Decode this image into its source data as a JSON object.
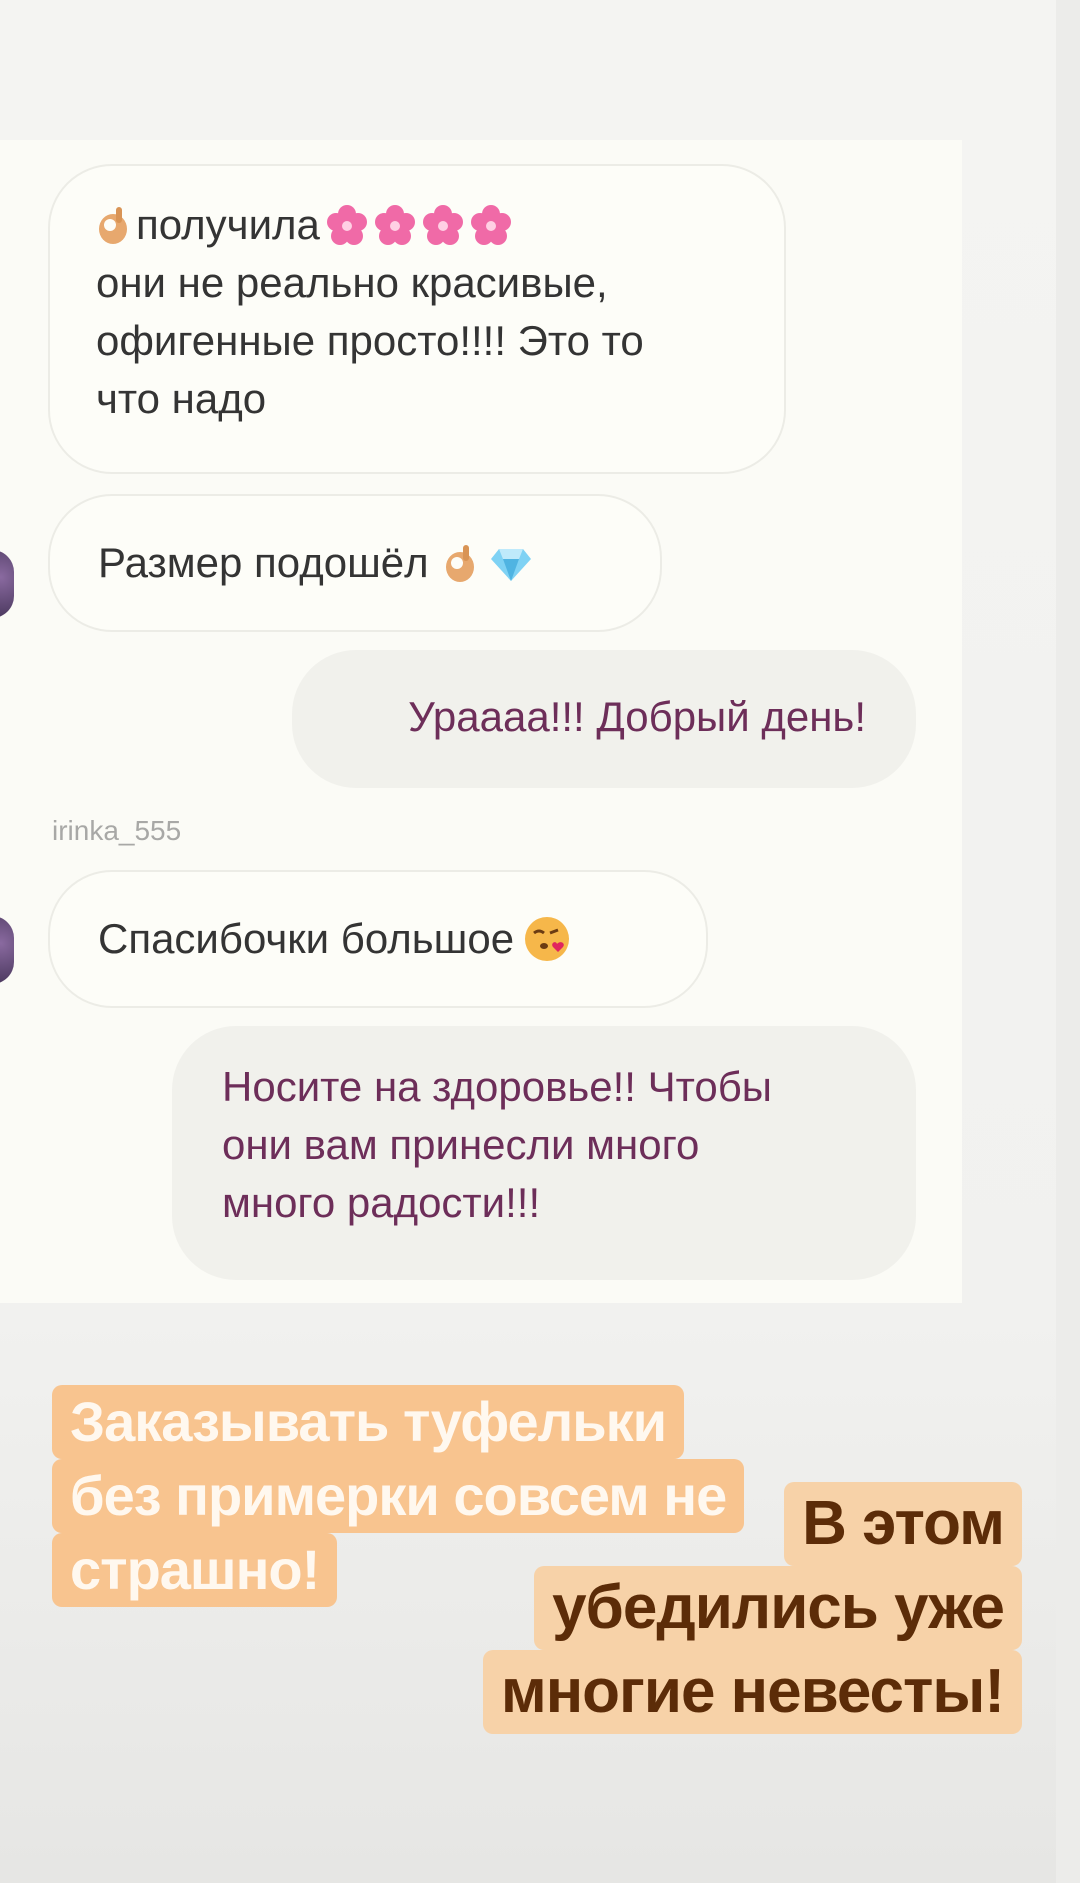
{
  "chat": {
    "messages": [
      {
        "direction": "incoming",
        "lines": [
          "получила",
          "они не реально красивые,",
          "офигенные просто!!!! Это то",
          "что надо"
        ]
      },
      {
        "direction": "incoming",
        "text": "Размер подошёл"
      },
      {
        "direction": "outgoing",
        "text": "Урaaaa!!! Добрый день!"
      },
      {
        "direction": "incoming",
        "sender": "irinka_555",
        "text": "Спасибочки большое"
      },
      {
        "direction": "outgoing",
        "lines": [
          "Носите на здоровье!! Чтобы",
          "они вам принесли много",
          "много радости!!!"
        ]
      }
    ]
  },
  "captions": {
    "left": [
      "Заказывать  туфельки",
      "без примерки совсем не",
      "страшно!"
    ],
    "right": [
      "В этом",
      "убедились уже",
      "многие невесты!"
    ]
  },
  "icons": {
    "ok_hand": "ok-hand-icon",
    "flower": "cherry-blossom-icon",
    "gem": "gem-icon",
    "kiss": "face-blowing-kiss-icon"
  },
  "colors": {
    "outgoing_text": "#6d2e59",
    "incoming_text": "#343434",
    "caption_left_bg": "#f8c48f",
    "caption_right_bg": "#f7d2a8",
    "caption_right_text": "#5c2c08"
  }
}
